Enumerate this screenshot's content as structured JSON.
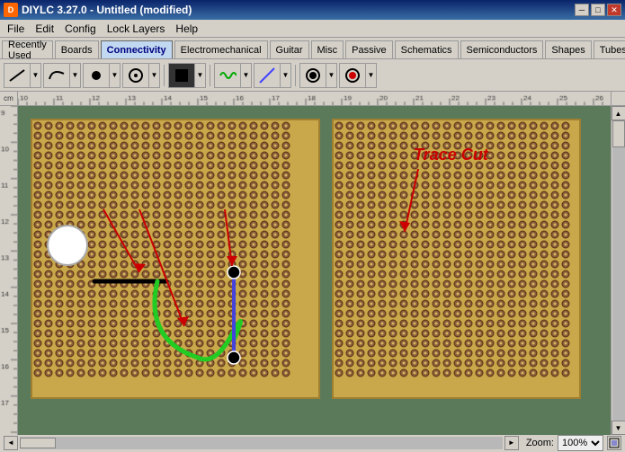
{
  "window": {
    "title": "DIYLC 3.27.0 - Untitled  (modified)",
    "icon": "D"
  },
  "titlebar": {
    "minimize_label": "─",
    "maximize_label": "□",
    "close_label": "✕"
  },
  "menu": {
    "items": [
      "File",
      "Edit",
      "Config",
      "Lock Layers",
      "Help"
    ]
  },
  "tabs": {
    "items": [
      "Recently Used",
      "Boards",
      "Connectivity",
      "Electromechanical",
      "Guitar",
      "Misc",
      "Passive",
      "Schematics",
      "Semiconductors",
      "Shapes",
      "Tubes"
    ],
    "active": "Connectivity"
  },
  "toolbar": {
    "tools": [
      {
        "name": "line-tool",
        "icon": "/"
      },
      {
        "name": "curve-tool",
        "icon": "∿"
      },
      {
        "name": "dot-tool",
        "icon": "●"
      },
      {
        "name": "circle-tool",
        "icon": "○"
      },
      {
        "name": "square-tool",
        "icon": "■"
      },
      {
        "name": "wave-tool",
        "icon": "~"
      },
      {
        "name": "diagonal-tool",
        "icon": "╱"
      },
      {
        "name": "record-dot",
        "icon": "●"
      },
      {
        "name": "record-tool",
        "icon": "●"
      }
    ]
  },
  "canvas": {
    "trace_cut_label": "Trace Cut",
    "zoom_label": "Zoom:",
    "zoom_value": "100%"
  },
  "ruler": {
    "top_marks": [
      "10",
      "11",
      "12",
      "13",
      "14",
      "15",
      "16",
      "17"
    ],
    "left_marks": [
      "9",
      "10",
      "11",
      "12"
    ],
    "unit": "cm"
  },
  "scrollbar": {
    "up": "▲",
    "down": "▼",
    "left": "◄",
    "right": "►"
  }
}
